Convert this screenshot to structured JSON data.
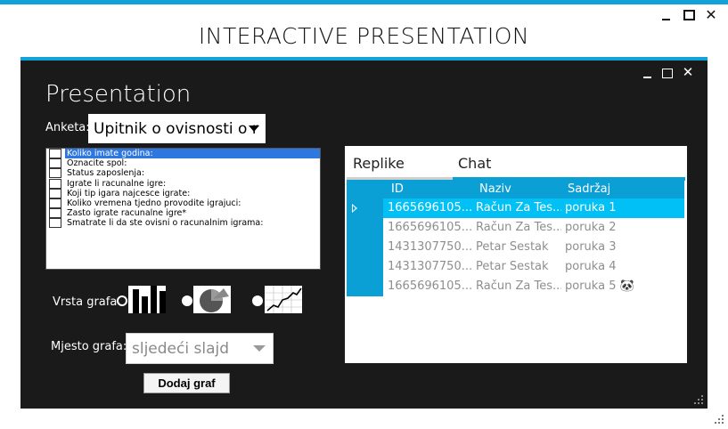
{
  "outer_window": {
    "title": "INTERACTIVE PRESENTATION",
    "minimize_glyph": "_",
    "maximize_glyph": "□",
    "close_glyph": "✕"
  },
  "inner_window": {
    "title": "Presentation",
    "close_glyph": "✕"
  },
  "survey": {
    "label": "Anketa:",
    "selected": "Upitnik o ovisnosti o r"
  },
  "questions": [
    {
      "text": "Koliko imate godina:",
      "checked": false,
      "selected": true
    },
    {
      "text": "Oznacite spol:",
      "checked": false,
      "selected": false
    },
    {
      "text": "Status zaposlenja:",
      "checked": false,
      "selected": false
    },
    {
      "text": "Igrate li racunalne igre:",
      "checked": false,
      "selected": false
    },
    {
      "text": "Koji tip igara najcesce igrate:",
      "checked": false,
      "selected": false
    },
    {
      "text": "Koliko vremena tjedno provodite igrajuci:",
      "checked": false,
      "selected": false
    },
    {
      "text": "Zasto igrate racunalne igre*",
      "checked": false,
      "selected": false
    },
    {
      "text": "Smatrate li da ste ovisni o racunalnim igrama:",
      "checked": false,
      "selected": false
    }
  ],
  "graph_type": {
    "label": "Vrsta grafa",
    "options": [
      {
        "icon": "bar-chart-icon",
        "checked": true
      },
      {
        "icon": "pie-chart-icon",
        "checked": false
      },
      {
        "icon": "line-chart-icon",
        "checked": false
      }
    ]
  },
  "graph_place": {
    "label": "Mjesto grafa:",
    "selected": "sljedeći slajd"
  },
  "add_graph_button": "Dodaj graf",
  "tabs": [
    {
      "label": "Replike",
      "active": false
    },
    {
      "label": "Chat",
      "active": true
    }
  ],
  "grid": {
    "columns": [
      "ID",
      "Naziv",
      "Sadržaj"
    ],
    "rows": [
      {
        "id": "1665696105...",
        "naziv": "Račun Za Tes...",
        "sadrzaj": "poruka 1",
        "selected": true
      },
      {
        "id": "1665696105...",
        "naziv": "Račun Za Tes...",
        "sadrzaj": "poruka 2",
        "selected": false
      },
      {
        "id": "1431307750...",
        "naziv": "Petar Šestak",
        "sadrzaj": "poruka 3",
        "selected": false
      },
      {
        "id": "1431307750...",
        "naziv": "Petar Šestak",
        "sadrzaj": "poruka 4",
        "selected": false
      },
      {
        "id": "1665696105...",
        "naziv": "Račun Za Tes...",
        "sadrzaj": "poruka 5 🐼",
        "selected": false
      }
    ]
  },
  "colors": {
    "accent": "#11a3d8",
    "grid_header": "#0aa0d6",
    "grid_selected": "#00c0f5",
    "list_selected": "#2f77e0",
    "inner_bg": "#1a1a1a"
  }
}
